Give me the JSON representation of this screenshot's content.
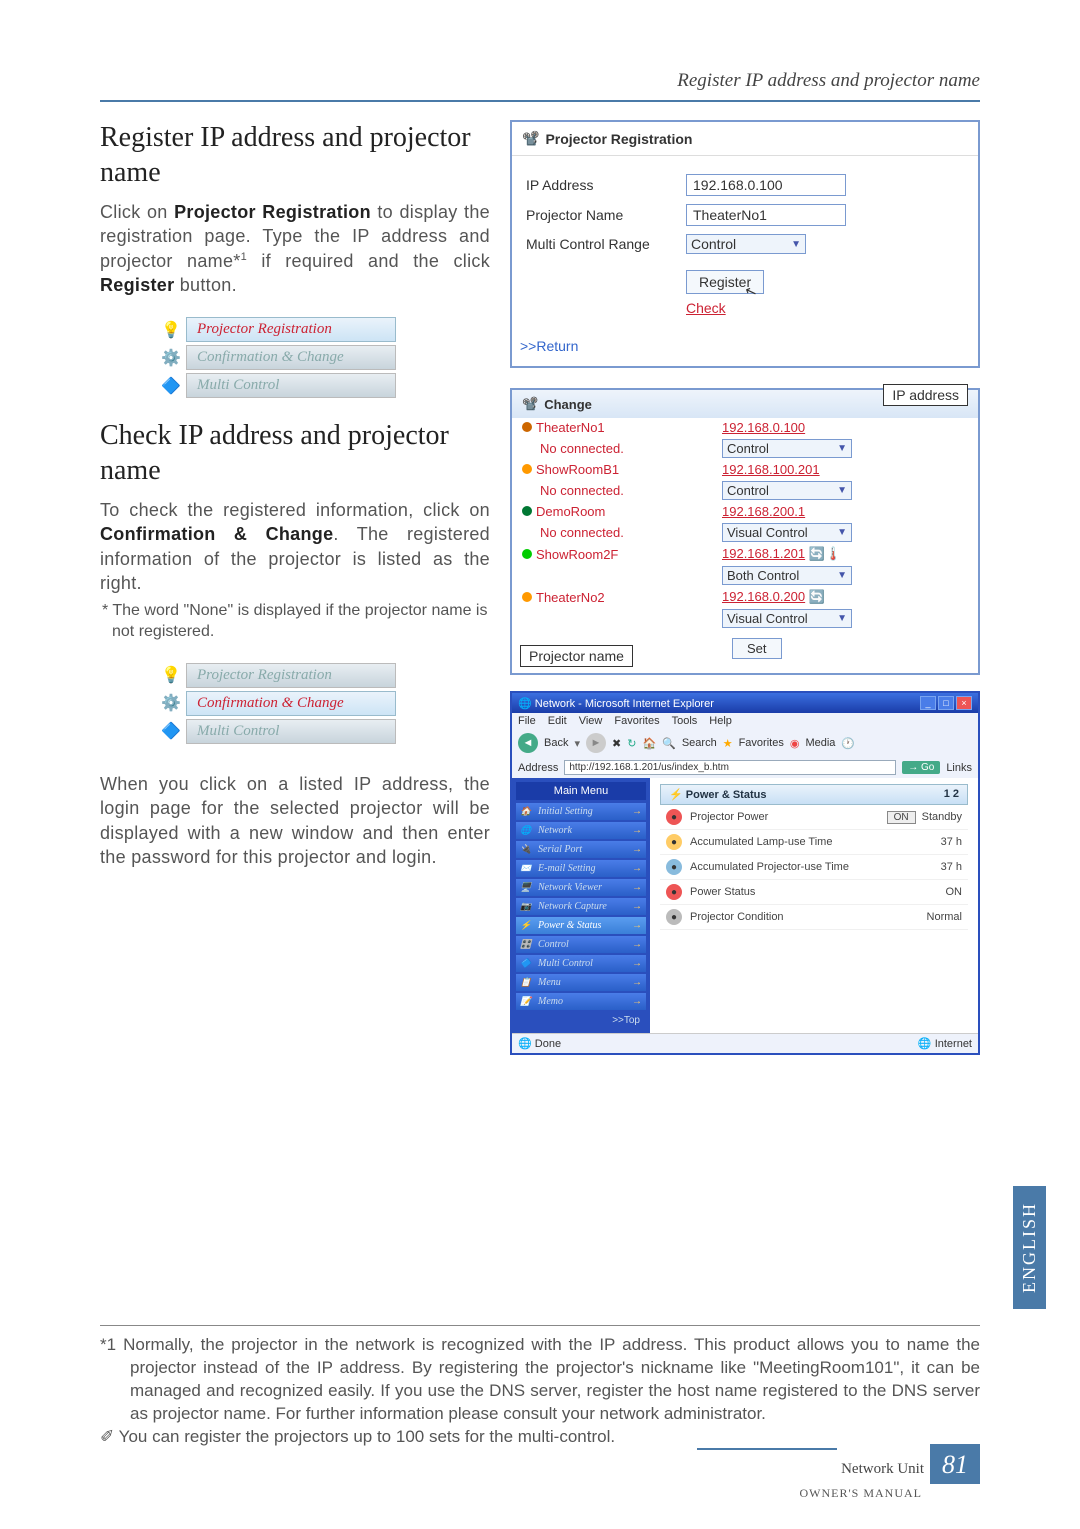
{
  "header": "Register IP address and projector name",
  "section1": {
    "title": "Register IP address and projector name",
    "para_a": "Click on ",
    "para_b": "Projector Registration",
    "para_c": " to display the registration page. Type the IP address and projector name*",
    "sup": "1",
    "para_d": " if required and the click ",
    "para_e": "Register",
    "para_f": " button."
  },
  "menu1": {
    "a": "Projector Registration",
    "b": "Confirmation & Change",
    "c": "Multi Control"
  },
  "section2": {
    "title": "Check IP address and projector name",
    "para_a": "To check the registered information, click on ",
    "para_b": "Confirmation & Change",
    "para_c": ". The registered information of the projector is listed as the right.",
    "note": "* The word \"None\" is displayed if the projector name is not registered."
  },
  "menu2": {
    "a": "Projector Registration",
    "b": "Confirmation & Change",
    "c": "Multi Control"
  },
  "section3": {
    "para": "When you click on a listed IP address, the login page for the selected projector will be displayed with a new window and then enter the password for this projector and login."
  },
  "reg_dialog": {
    "title": "Projector Registration",
    "rows": {
      "ip_label": "IP Address",
      "ip_value": "192.168.0.100",
      "name_label": "Projector Name",
      "name_value": "TheaterNo1",
      "range_label": "Multi Control Range",
      "range_value": "Control"
    },
    "register_btn": "Register",
    "check_link": "Check",
    "return": ">>Return"
  },
  "change_dialog": {
    "title": "Change",
    "ip_callout": "IP address",
    "pjname_callout": "Projector name",
    "set_btn": "Set",
    "rows": [
      {
        "name": "TheaterNo1",
        "ip": "192.168.0.100",
        "status": "No connected.",
        "sel": "Control",
        "dot": "dorg"
      },
      {
        "name": "ShowRoomB1",
        "ip": "192.168.100.201",
        "status": "No connected.",
        "sel": "Control",
        "dot": "org"
      },
      {
        "name": "DemoRoom",
        "ip": "192.168.200.1",
        "status": "No connected.",
        "sel": "Visual Control",
        "dot": "dgrn"
      },
      {
        "name": "ShowRoom2F",
        "ip": "192.168.1.201",
        "status": "",
        "sel": "Both Control",
        "dot": "grn",
        "icons": true
      },
      {
        "name": "TheaterNo2",
        "ip": "192.168.0.200",
        "status": "",
        "sel": "Visual Control",
        "dot": "org",
        "icons2": true
      }
    ]
  },
  "browser": {
    "title": "Network - Microsoft Internet Explorer",
    "menu": [
      "File",
      "Edit",
      "View",
      "Favorites",
      "Tools",
      "Help"
    ],
    "toolbar": {
      "back": "Back",
      "search": "Search",
      "favorites": "Favorites",
      "media": "Media"
    },
    "address_label": "Address",
    "address": "http://192.168.1.201/us/index_b.htm",
    "go": "Go",
    "links": "Links",
    "sidemenu_head": "Main Menu",
    "sidemenu": [
      "Initial Setting",
      "Network",
      "Serial Port",
      "E-mail Setting",
      "Network Viewer",
      "Network Capture",
      "Power & Status",
      "Control",
      "Multi Control",
      "Menu",
      "Memo"
    ],
    "top": ">>Top",
    "main_head": "Power & Status",
    "main_page": "1 2",
    "rows": [
      {
        "label": "Projector Power",
        "val": "Standby",
        "btn": "ON",
        "color": "#e55"
      },
      {
        "label": "Accumulated Lamp-use Time",
        "val": "37 h",
        "color": "#fc6"
      },
      {
        "label": "Accumulated Projector-use Time",
        "val": "37 h",
        "color": "#8bd"
      },
      {
        "label": "Power Status",
        "val": "ON",
        "color": "#e55"
      },
      {
        "label": "Projector Condition",
        "val": "Normal",
        "color": "#bbb"
      }
    ],
    "status_done": "Done",
    "status_net": "Internet"
  },
  "footnotes": {
    "fn1": "*1 Normally, the projector in the network is recognized with the IP address. This product allows you to name the projector instead of the IP address. By registering the projector's nickname like \"MeetingRoom101\", it can be managed and recognized easily. If you use the DNS server, register the host name registered to the DNS server as projector name. For further information please consult your network administrator.",
    "fn2": "✐ You can register the projectors up to 100 sets for the multi-control."
  },
  "footer": {
    "unit": "Network Unit",
    "manual": "OWNER'S MANUAL",
    "page": "81"
  },
  "lang": "ENGLISH"
}
